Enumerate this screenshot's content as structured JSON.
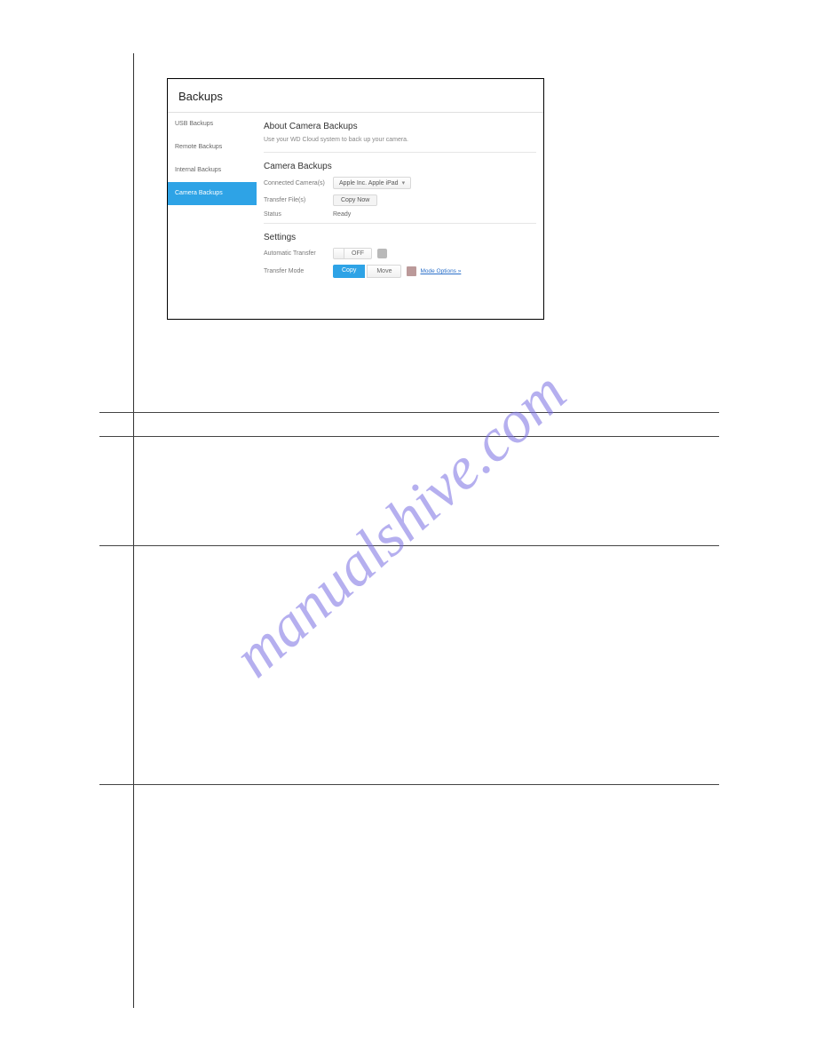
{
  "watermark": "manualshive.com",
  "panel": {
    "title": "Backups",
    "sidebar": [
      {
        "label": "USB Backups"
      },
      {
        "label": "Remote Backups"
      },
      {
        "label": "Internal Backups"
      },
      {
        "label": "Camera Backups"
      }
    ],
    "about": {
      "heading": "About Camera Backups",
      "body": "Use your WD Cloud system to back up your camera."
    },
    "camera": {
      "heading": "Camera Backups",
      "connected_label": "Connected Camera(s)",
      "connected_value": "Apple Inc. Apple iPad",
      "transfer_files_label": "Transfer File(s)",
      "transfer_files_button": "Copy Now",
      "status_label": "Status",
      "status_value": "Ready"
    },
    "settings": {
      "heading": "Settings",
      "auto_transfer_label": "Automatic Transfer",
      "toggle_off": "OFF",
      "transfer_mode_label": "Transfer Mode",
      "mode_copy": "Copy",
      "mode_move": "Move",
      "mode_link": "Mode Options »"
    }
  }
}
